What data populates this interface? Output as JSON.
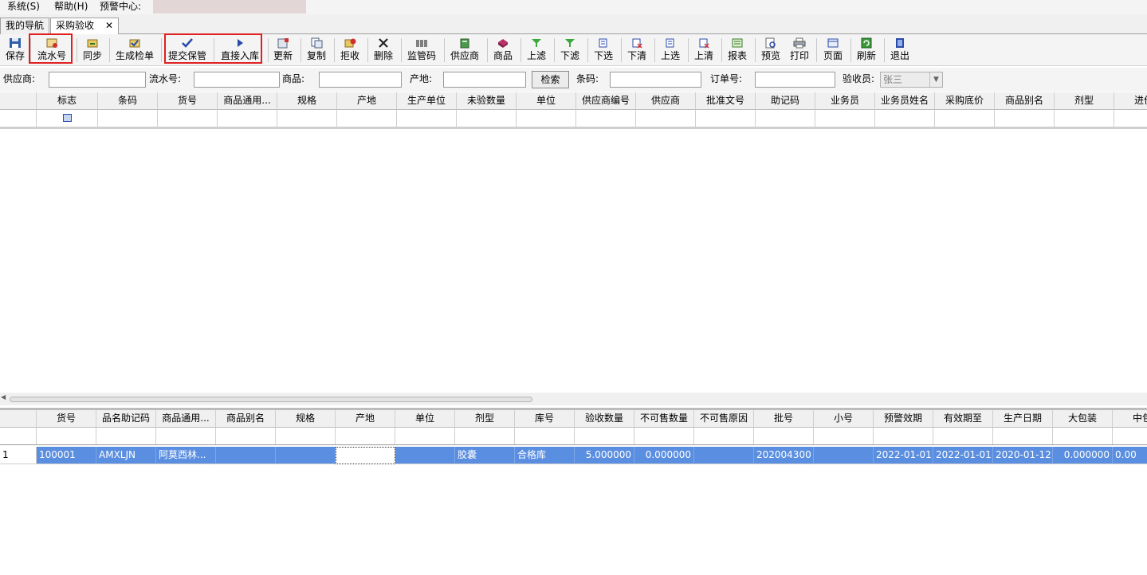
{
  "menu": {
    "items": [
      {
        "label": "系统(S)"
      },
      {
        "label": "帮助(H)"
      },
      {
        "label": "预警中心:"
      }
    ]
  },
  "tabs": [
    {
      "label": "我的导航"
    },
    {
      "label": "采购验收",
      "close": "✕"
    }
  ],
  "toolbar": {
    "buttons": [
      {
        "label": "保存",
        "icon": "save-icon"
      },
      {
        "label": "流水号",
        "icon": "serial-number-icon"
      },
      {
        "label": "同步",
        "icon": "sync-icon"
      },
      {
        "label": "生成检单",
        "icon": "generate-check-icon"
      },
      {
        "label": "提交保管",
        "icon": "checkmark-icon"
      },
      {
        "label": "直接入库",
        "icon": "play-arrow-icon"
      },
      {
        "label": "更新",
        "icon": "update-icon"
      },
      {
        "label": "复制",
        "icon": "copy-icon"
      },
      {
        "label": "拒收",
        "icon": "reject-icon"
      },
      {
        "label": "删除",
        "icon": "delete-x-icon"
      },
      {
        "label": "监管码",
        "icon": "barcode-icon"
      },
      {
        "label": "供应商",
        "icon": "supplier-icon"
      },
      {
        "label": "商品",
        "icon": "product-icon"
      },
      {
        "label": "上滤",
        "icon": "filter-up-icon"
      },
      {
        "label": "下滤",
        "icon": "filter-down-icon"
      },
      {
        "label": "下选",
        "icon": "select-down-icon"
      },
      {
        "label": "下清",
        "icon": "clear-down-icon"
      },
      {
        "label": "上选",
        "icon": "select-up-icon"
      },
      {
        "label": "上清",
        "icon": "clear-up-icon"
      },
      {
        "label": "报表",
        "icon": "report-icon"
      },
      {
        "label": "预览",
        "icon": "preview-icon"
      },
      {
        "label": "打印",
        "icon": "print-icon"
      },
      {
        "label": "页面",
        "icon": "page-icon"
      },
      {
        "label": "刷新",
        "icon": "refresh-icon"
      },
      {
        "label": "退出",
        "icon": "exit-icon"
      }
    ]
  },
  "search": {
    "supplier_label": "供应商:",
    "supplier_value": "",
    "serial_label": "流水号:",
    "serial_value": "",
    "product_label": "商品:",
    "product_value": "",
    "origin_label": "产地:",
    "origin_value": "",
    "search_button": "检索",
    "barcode_label": "条码:",
    "barcode_value": "",
    "order_label": "订单号:",
    "order_value": "",
    "inspector_label": "验收员:",
    "inspector_value": "张三"
  },
  "upper_grid": {
    "columns": [
      "",
      "标志",
      "条码",
      "货号",
      "商品通用...",
      "规格",
      "产地",
      "生产单位",
      "未验数量",
      "单位",
      "供应商编号",
      "供应商",
      "批准文号",
      "助记码",
      "业务员",
      "业务员姓名",
      "采购底价",
      "商品别名",
      "剂型",
      "进价"
    ],
    "filter_checkbox_icon": "checkbox-icon"
  },
  "lower_grid": {
    "columns": [
      "",
      "货号",
      "品名助记码",
      "商品通用...",
      "商品别名",
      "规格",
      "产地",
      "单位",
      "剂型",
      "库号",
      "验收数量",
      "不可售数量",
      "不可售原因",
      "批号",
      "小号",
      "预警效期",
      "有效期至",
      "生产日期",
      "大包装",
      "中包"
    ],
    "rows": [
      [
        "1",
        "100001",
        "AMXLJN",
        "阿莫西林...",
        "",
        "",
        "",
        "",
        "胶囊",
        "合格库",
        "5.000000",
        "0.000000",
        "",
        "202004300",
        "",
        "2022-01-01",
        "2022-01-01",
        "2020-01-12",
        "0.000000",
        "0.00"
      ]
    ]
  }
}
